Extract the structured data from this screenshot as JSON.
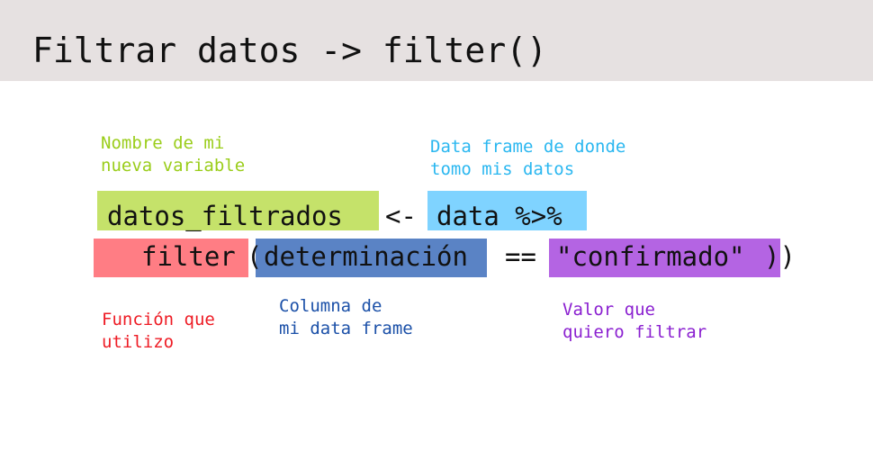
{
  "title": "Filtrar datos -> filter()",
  "annotations": {
    "variable": [
      "Nombre de mi",
      "nueva variable"
    ],
    "data_frame": [
      "Data frame de donde",
      "tomo mis datos"
    ],
    "function": [
      "Función que",
      "utilizo"
    ],
    "column": [
      "Columna de",
      "mi data frame"
    ],
    "value": [
      "Valor que",
      "quiero filtrar"
    ]
  },
  "code": {
    "line1": {
      "variable": "datos_filtrados",
      "assign": "<-",
      "data_frame": "data %>%"
    },
    "line2": {
      "function": "filter",
      "open_paren": "(",
      "column": "determinación",
      "operator": "==",
      "value": "\"confirmado\"",
      "close_parens": "))"
    }
  },
  "colors": {
    "title_bar": "#e6e1e1",
    "variable": "#c5e26a",
    "data_frame": "#7fd3ff",
    "function": "#ff7d84",
    "column": "#5a83c5",
    "value": "#b464e3"
  }
}
